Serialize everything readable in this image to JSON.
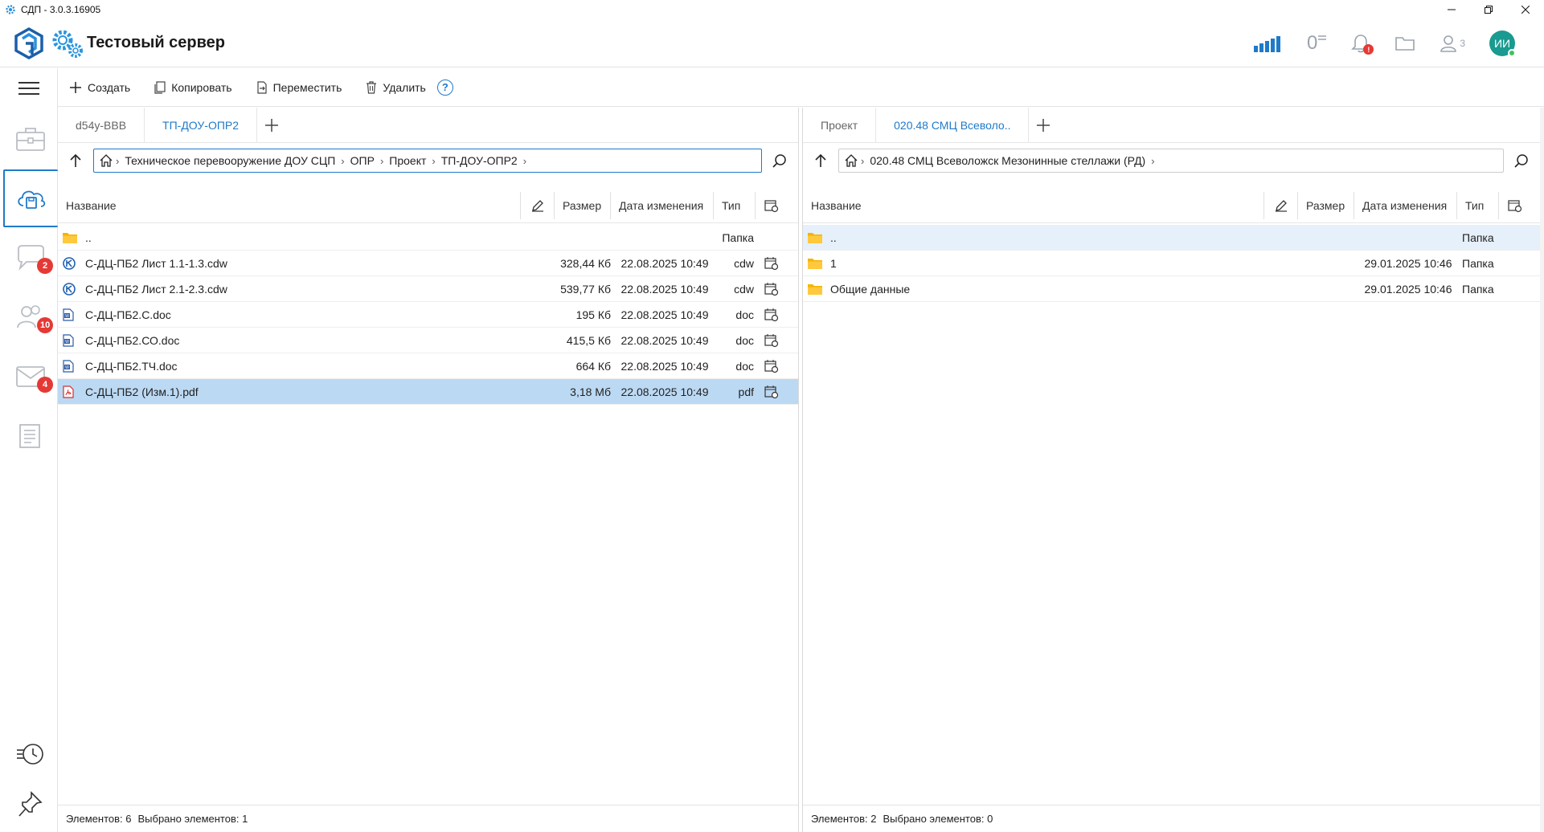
{
  "window": {
    "title": "СДП - 3.0.3.16905"
  },
  "header": {
    "server_name": "Тестовый сервер",
    "counter_value": "0",
    "users_count": "3",
    "avatar_initials": "ИИ",
    "bell_badge": "!"
  },
  "sidebar": {
    "badges": {
      "chat": "2",
      "contacts": "10",
      "mail": "4"
    }
  },
  "toolbar": {
    "create": "Создать",
    "copy": "Копировать",
    "move": "Переместить",
    "delete": "Удалить",
    "help": "?"
  },
  "left": {
    "tabs": [
      "d54y-BBB",
      "ТП-ДОУ-ОПР2"
    ],
    "path": [
      "Техническое перевооружение ДОУ СЦП",
      "ОПР",
      "Проект",
      "ТП-ДОУ-ОПР2"
    ],
    "columns": {
      "name": "Название",
      "size": "Размер",
      "modified": "Дата изменения",
      "type": "Тип"
    },
    "rows": [
      {
        "name": "..",
        "size": "",
        "modified": "",
        "type": "Папка",
        "icon": "folder"
      },
      {
        "name": "С-ДЦ-ПБ2 Лист 1.1-1.3.cdw",
        "size": "328,44 Кб",
        "modified": "22.08.2025 10:49",
        "type": "cdw",
        "icon": "cdw"
      },
      {
        "name": "С-ДЦ-ПБ2 Лист 2.1-2.3.cdw",
        "size": "539,77 Кб",
        "modified": "22.08.2025 10:49",
        "type": "cdw",
        "icon": "cdw"
      },
      {
        "name": "С-ДЦ-ПБ2.С.doc",
        "size": "195 Кб",
        "modified": "22.08.2025 10:49",
        "type": "doc",
        "icon": "doc"
      },
      {
        "name": "С-ДЦ-ПБ2.СО.doc",
        "size": "415,5 Кб",
        "modified": "22.08.2025 10:49",
        "type": "doc",
        "icon": "doc"
      },
      {
        "name": "С-ДЦ-ПБ2.ТЧ.doc",
        "size": "664 Кб",
        "modified": "22.08.2025 10:49",
        "type": "doc",
        "icon": "doc"
      },
      {
        "name": "С-ДЦ-ПБ2 (Изм.1).pdf",
        "size": "3,18 Мб",
        "modified": "22.08.2025 10:49",
        "type": "pdf",
        "icon": "pdf"
      }
    ],
    "status": {
      "elements": "Элементов: 6",
      "selected": "Выбрано элементов: 1"
    }
  },
  "right": {
    "tabs": [
      "Проект",
      "020.48 СМЦ Всеволо.."
    ],
    "path": [
      "020.48 СМЦ Всеволожск Мезонинные стеллажи (РД)"
    ],
    "columns": {
      "name": "Название",
      "size": "Размер",
      "modified": "Дата изменения",
      "type": "Тип"
    },
    "rows": [
      {
        "name": "..",
        "modified": "",
        "type": "Папка"
      },
      {
        "name": "1",
        "modified": "29.01.2025 10:46",
        "type": "Папка"
      },
      {
        "name": "Общие данные",
        "modified": "29.01.2025 10:46",
        "type": "Папка"
      }
    ],
    "status": {
      "elements": "Элементов: 2",
      "selected": "Выбрано элементов: 0"
    }
  },
  "colors": {
    "accent": "#1f7ac9",
    "selected_row": "#bcd9f3",
    "badge": "#e53935",
    "folder": "#f5b400",
    "avatar": "#1a9a90"
  }
}
